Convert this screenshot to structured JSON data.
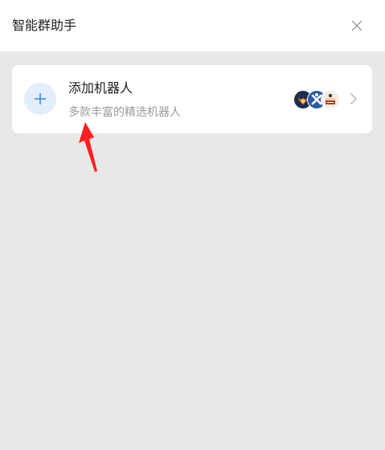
{
  "header": {
    "title": "智能群助手"
  },
  "card": {
    "title": "添加机器人",
    "subtitle": "多款丰富的精选机器人",
    "avatars": [
      "bot-avatar-fox",
      "bot-avatar-x",
      "bot-avatar-cake"
    ]
  },
  "colors": {
    "accent": "#3a8ee6",
    "annotation": "#ff1f1f",
    "background": "#e8e8e8",
    "card": "#ffffff"
  },
  "icons": {
    "close": "close-icon",
    "add": "plus-icon",
    "chevron": "chevron-right-icon",
    "annotation": "red-arrow-annotation"
  }
}
